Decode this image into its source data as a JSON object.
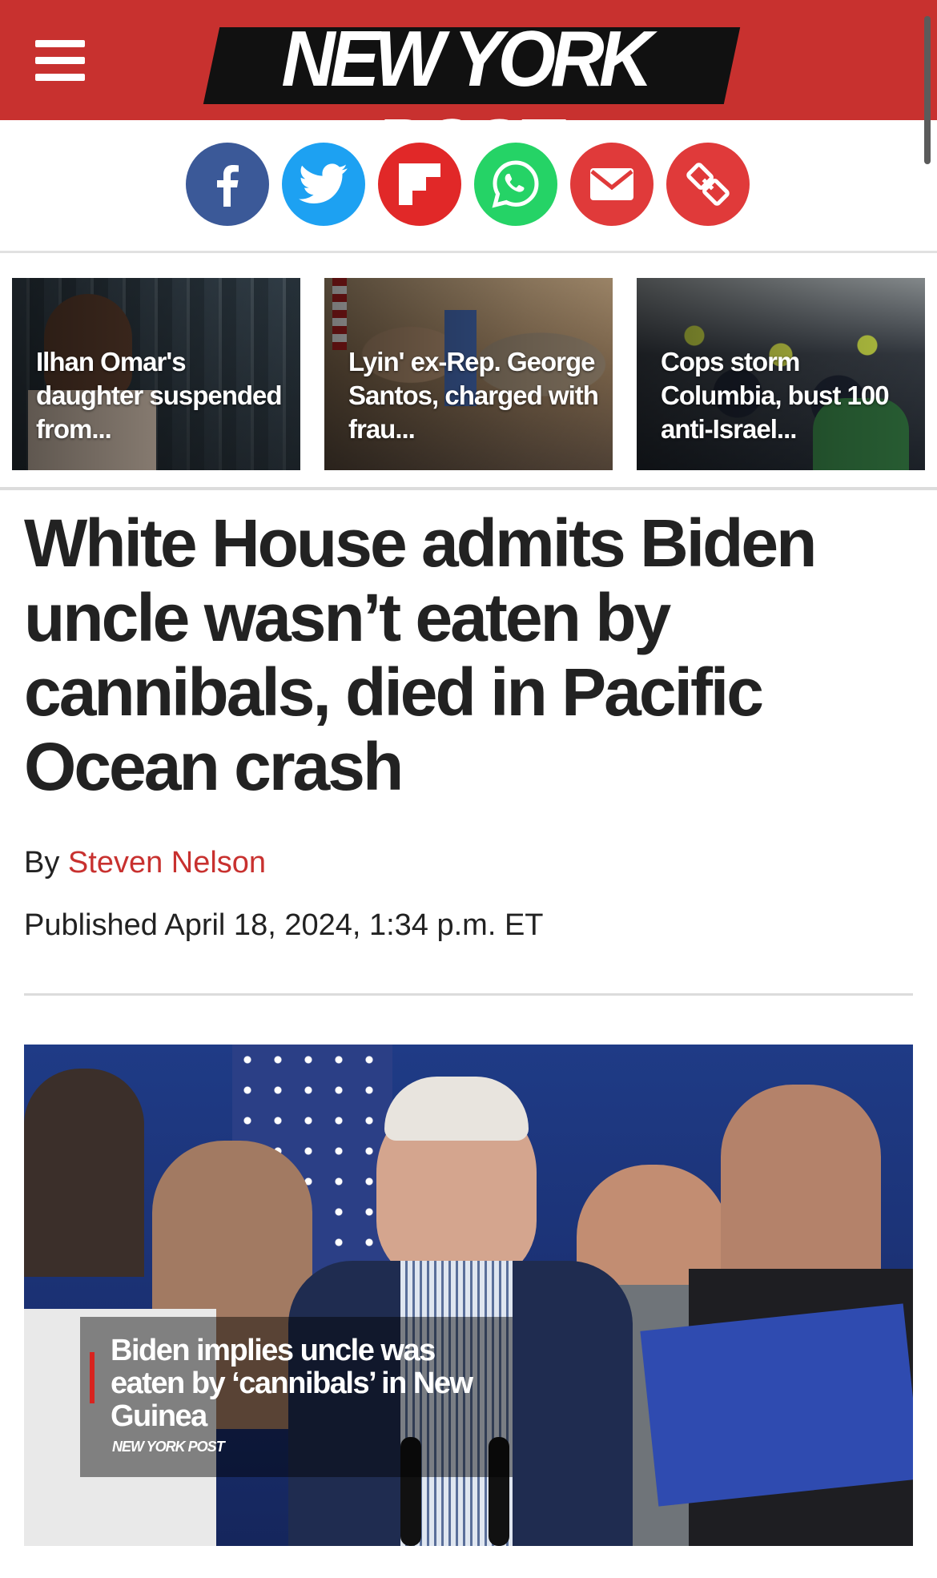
{
  "header": {
    "logo_text": "NEW YORK POST",
    "brand_color": "#c8312f",
    "menu_icon": "hamburger-menu-icon"
  },
  "share": {
    "buttons": [
      {
        "name": "facebook",
        "icon": "facebook-icon",
        "color": "#3b5998"
      },
      {
        "name": "twitter",
        "icon": "twitter-bird-icon",
        "color": "#1da1f2"
      },
      {
        "name": "flipboard",
        "icon": "flipboard-icon",
        "color": "#e12828"
      },
      {
        "name": "whatsapp",
        "icon": "whatsapp-icon",
        "color": "#25d366"
      },
      {
        "name": "email",
        "icon": "envelope-icon",
        "color": "#e03a3a"
      },
      {
        "name": "copy-link",
        "icon": "link-icon",
        "color": "#e03a3a"
      }
    ]
  },
  "related_stories": [
    {
      "title": "Ilhan Omar's daughter suspended from..."
    },
    {
      "title": "Lyin' ex-Rep. George Santos, charged with frau..."
    },
    {
      "title": "Cops storm Columbia, bust 100 anti-Israel..."
    }
  ],
  "article": {
    "headline": "White House admits Biden uncle wasn’t eaten by cannibals, died in Pacific Ocean crash",
    "byline_prefix": "By",
    "author": "Steven Nelson",
    "published": "Published April 18, 2024, 1:34 p.m. ET"
  },
  "video": {
    "caption": "Biden implies uncle was eaten by ‘cannibals’ in New Guinea",
    "brand": "NEW YORK POST"
  }
}
